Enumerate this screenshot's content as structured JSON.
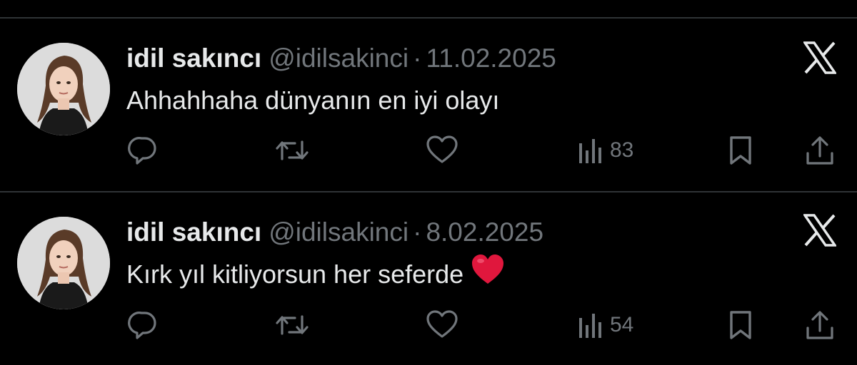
{
  "tweets": [
    {
      "name": "idil sakıncı",
      "handle": "@idilsakinci",
      "separator": "·",
      "date": "11.02.2025",
      "text": "Ahhahhaha dünyanın en iyi olayı",
      "emoji": "",
      "views": "83"
    },
    {
      "name": "idil sakıncı",
      "handle": "@idilsakinci",
      "separator": "·",
      "date": "8.02.2025",
      "text": "Kırk yıl kitliyorsun her seferde",
      "emoji": "❤️",
      "views": "54"
    }
  ],
  "icons": {
    "reply": "reply-icon",
    "repost": "repost-icon",
    "like": "heart-icon",
    "views": "views-icon",
    "bookmark": "bookmark-icon",
    "share": "share-icon",
    "brand": "x-logo-icon"
  },
  "colors": {
    "background": "#000000",
    "primary_text": "#e7e9ea",
    "secondary_text": "#71767b",
    "divider": "#2f3336",
    "heart_emoji": "#e0173d"
  }
}
